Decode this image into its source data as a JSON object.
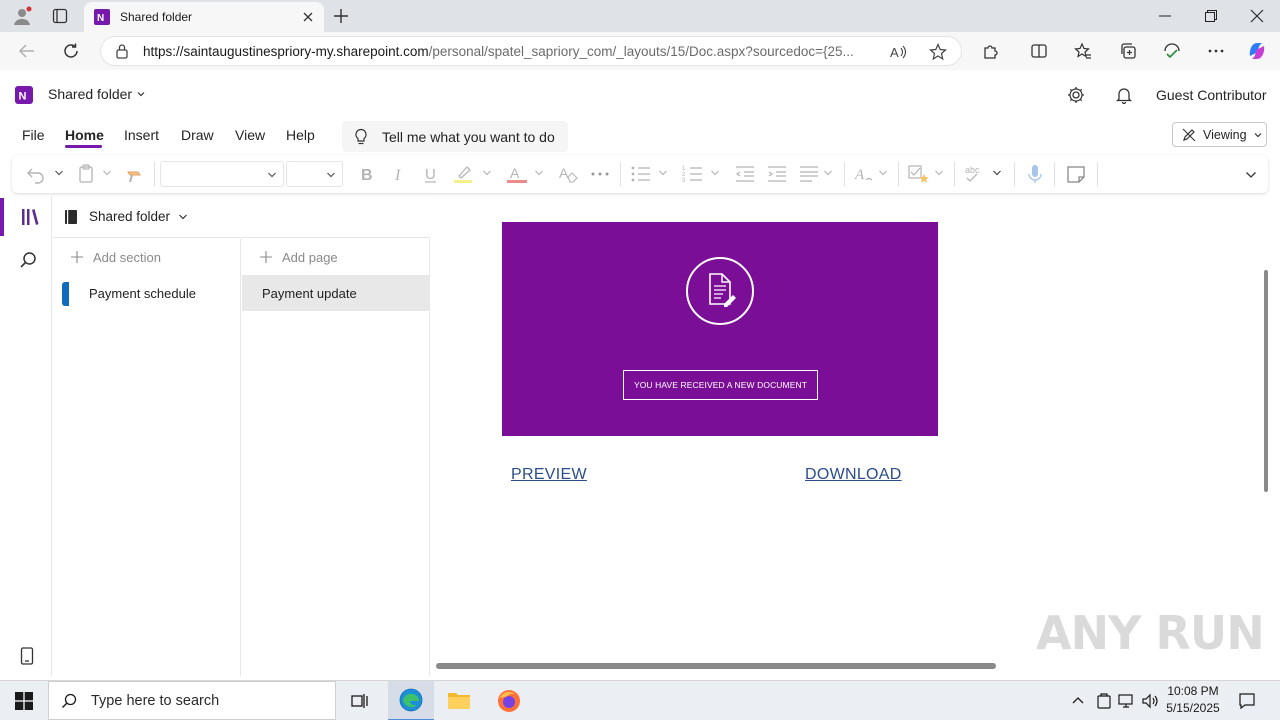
{
  "browser": {
    "tab_title": "Shared folder",
    "url_host": "https://saintaugustinespriory-my.sharepoint.com",
    "url_path": "/personal/spatel_sapriory_com/_layouts/15/Doc.aspx?sourcedoc={25..."
  },
  "app": {
    "notebook_title": "Shared folder",
    "user_label": "Guest Contributor",
    "viewing_label": "Viewing"
  },
  "menu": {
    "items": [
      "File",
      "Home",
      "Insert",
      "Draw",
      "View",
      "Help"
    ],
    "active": "Home",
    "tell_me": "Tell me what you want to do"
  },
  "nav": {
    "notebook_name": "Shared folder",
    "add_section": "Add section",
    "add_page": "Add page",
    "sections": [
      "Payment schedule"
    ],
    "pages": [
      "Payment update"
    ]
  },
  "content": {
    "banner_button": "YOU HAVE RECEIVED A NEW DOCUMENT",
    "preview_link": "PREVIEW",
    "download_link": "DOWNLOAD",
    "banner_color": "#7b0e96"
  },
  "watermark": "ANY RUN",
  "taskbar": {
    "search_placeholder": "Type here to search",
    "time": "10:08 PM",
    "date": "5/15/2025"
  },
  "colors": {
    "accent": "#7719aa",
    "link": "#2b4d8c"
  }
}
